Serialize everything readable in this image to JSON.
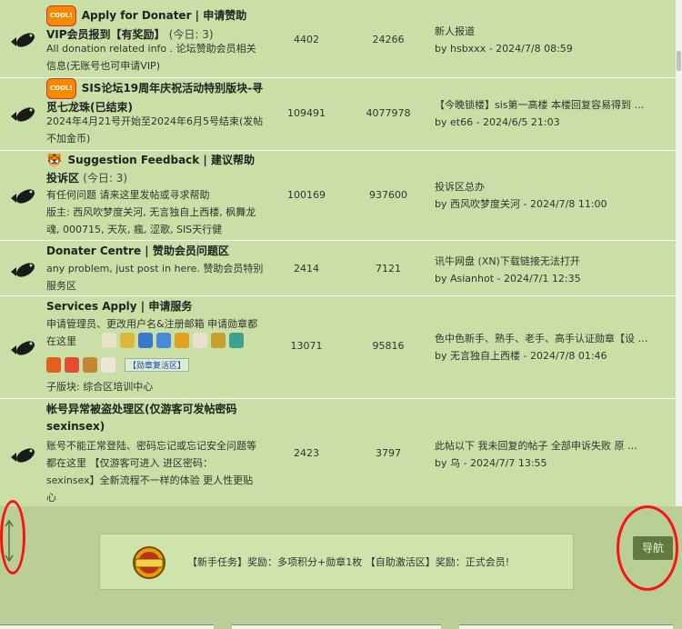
{
  "forums": [
    {
      "badge": "COOL!",
      "name": "Apply for Donater | 申请赞助VIP会员报到【有奖励】",
      "today": "(今日: 3)",
      "desc": "All donation related info . 论坛赞助会员相关信息(无账号也可申请VIP)",
      "threads": "4402",
      "posts": "24266",
      "last_title": "新人报道",
      "last_by": "by hsbxxx - 2024/7/8 08:59"
    },
    {
      "badge": "COOL!",
      "name": "SIS论坛19周年庆祝活动特别版块-寻觅七龙珠(已结束)",
      "desc": "2024年4月21号开始至2024年6月5号结束(发帖不加金币)",
      "threads": "109491",
      "posts": "4077978",
      "last_title": "【今晚锁楼】sis第一高楼 本楼回复容易得到 …",
      "last_by": "by et66 - 2024/6/5 21:03"
    },
    {
      "emoji": "🐯",
      "name": "Suggestion Feedback | 建议帮助投诉区",
      "today": "(今日: 3)",
      "desc": "有任何问题 请来这里发帖或寻求帮助",
      "mods": "版主: 西风吹梦度关河, 无言独自上西楼, 枫舞龙魂, 000715, 天灰, 瘋, 涩歌, SIS天行健",
      "threads": "100169",
      "posts": "937600",
      "last_title": "投诉区总办",
      "last_by": "by 西风吹梦度关河 - 2024/7/8 11:00"
    },
    {
      "name": "Donater Centre | 赞助会员问题区",
      "desc": "any problem, just post in here.  赞助会员特别服务区",
      "threads": "2414",
      "posts": "7121",
      "last_title": "讯牛网盘 (XN)下载链接无法打开",
      "last_by": "by Asianhot - 2024/7/1 12:35"
    },
    {
      "name": "Services Apply | 申请服务",
      "desc": "申请管理员、更改用户名&注册邮箱 申请勋章都在这里",
      "medal_link": "【勋章复活区】",
      "sub": "子版块: 综合区培训中心",
      "threads": "13071",
      "posts": "95816",
      "last_title": "色中色新手、熟手、老手、高手认证勋章【设 …",
      "last_by": "by 无言独自上西楼 - 2024/7/8 01:46"
    },
    {
      "name": "帐号异常被盗处理区(仅游客可发帖密码sexinsex)",
      "desc": "账号不能正常登陆、密码忘记或忘记安全问题等都在这里 【仅游客可进入 进区密码：sexinsex】全新流程不一样的体验 更人性更贴心",
      "threads": "2423",
      "posts": "3797",
      "last_title": "此帖以下 我未回复的帖子 全部申诉失败 原 …",
      "last_by": "by 乌 - 2024/7/7 13:55"
    }
  ],
  "promo": {
    "badge_text": "新手任务",
    "text": "【新手任务】奖励：多项积分+勋章1枚 【自助激活区】奖励：正式会员!"
  },
  "nav_button": "导航",
  "colors": {
    "row_bg": "#c9dfa6",
    "footer_bg": "#b9cf96",
    "nav_bg": "#5f7b3f",
    "annotation": "#ff1010"
  },
  "icons": {
    "forum": "fish-icon",
    "resize": "resize-vertical-icon"
  }
}
